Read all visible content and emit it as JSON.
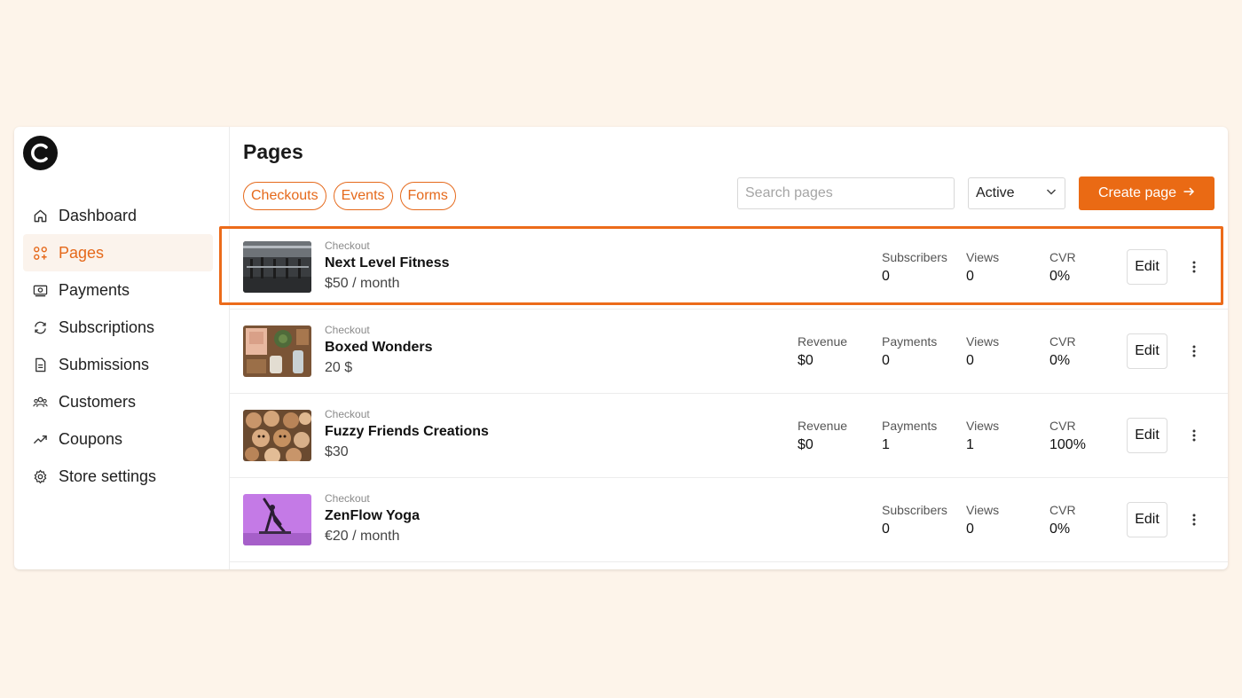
{
  "sidebar": {
    "items": [
      {
        "label": "Dashboard",
        "icon": "home-icon",
        "active": false
      },
      {
        "label": "Pages",
        "icon": "pages-grid-icon",
        "active": true
      },
      {
        "label": "Payments",
        "icon": "payments-icon",
        "active": false
      },
      {
        "label": "Subscriptions",
        "icon": "subscriptions-icon",
        "active": false
      },
      {
        "label": "Submissions",
        "icon": "document-icon",
        "active": false
      },
      {
        "label": "Customers",
        "icon": "customers-icon",
        "active": false
      },
      {
        "label": "Coupons",
        "icon": "trending-icon",
        "active": false
      },
      {
        "label": "Store settings",
        "icon": "gear-icon",
        "active": false
      }
    ]
  },
  "main": {
    "title": "Pages",
    "filters": [
      "Checkouts",
      "Events",
      "Forms"
    ],
    "search": {
      "placeholder": "Search pages"
    },
    "status_select": {
      "value": "Active"
    },
    "create_button": "Create page"
  },
  "pages": [
    {
      "type": "Checkout",
      "name": "Next Level Fitness",
      "price": "$50 / month",
      "thumb": "gym-photo",
      "metrics": [
        {
          "label": "Subscribers",
          "value": "0"
        },
        {
          "label": "Views",
          "value": "0"
        },
        {
          "label": "CVR",
          "value": "0%"
        }
      ],
      "edit": "Edit"
    },
    {
      "type": "Checkout",
      "name": "Boxed Wonders",
      "price": "20 $",
      "thumb": "gift-box-photo",
      "metrics": [
        {
          "label": "Revenue",
          "value": "$0"
        },
        {
          "label": "Payments",
          "value": "0"
        },
        {
          "label": "Views",
          "value": "0"
        },
        {
          "label": "CVR",
          "value": "0%"
        }
      ],
      "edit": "Edit"
    },
    {
      "type": "Checkout",
      "name": "Fuzzy Friends Creations",
      "price": "$30",
      "thumb": "plush-toys-photo",
      "metrics": [
        {
          "label": "Revenue",
          "value": "$0"
        },
        {
          "label": "Payments",
          "value": "1"
        },
        {
          "label": "Views",
          "value": "1"
        },
        {
          "label": "CVR",
          "value": "100%"
        }
      ],
      "edit": "Edit"
    },
    {
      "type": "Checkout",
      "name": "ZenFlow Yoga",
      "price": "€20 / month",
      "thumb": "yoga-photo",
      "metrics": [
        {
          "label": "Subscribers",
          "value": "0"
        },
        {
          "label": "Views",
          "value": "0"
        },
        {
          "label": "CVR",
          "value": "0%"
        }
      ],
      "edit": "Edit"
    }
  ],
  "colors": {
    "accent": "#ea6a14",
    "background": "#fdf4ea",
    "active_nav_bg": "#fbf3ec",
    "highlight_outline": "#ec6b1a"
  }
}
